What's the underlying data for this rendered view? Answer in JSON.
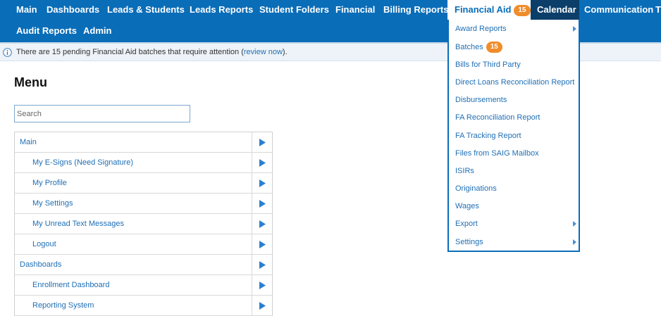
{
  "topnav": {
    "items": [
      {
        "label": "Main"
      },
      {
        "label": "Dashboards"
      },
      {
        "label": "Leads & Students"
      },
      {
        "label": "Leads Reports"
      },
      {
        "label": "Student Folders"
      },
      {
        "label": "Financial"
      },
      {
        "label": "Billing Reports"
      },
      {
        "label": "Financial Aid",
        "badge": "15"
      },
      {
        "label": "Calendar"
      },
      {
        "label": "Communication"
      },
      {
        "label": "T"
      },
      {
        "label": "Audit Reports"
      },
      {
        "label": "Admin"
      }
    ]
  },
  "alert": {
    "text_before": "There are 15 pending Financial Aid batches that require attention (",
    "link": "review now",
    "text_after": ")."
  },
  "menu": {
    "title": "Menu",
    "search_placeholder": "Search",
    "rows": [
      {
        "label": "Main",
        "level": 0
      },
      {
        "label": "My E-Signs (Need Signature)",
        "level": 1
      },
      {
        "label": "My Profile",
        "level": 1
      },
      {
        "label": "My Settings",
        "level": 1
      },
      {
        "label": "My Unread Text Messages",
        "level": 1
      },
      {
        "label": "Logout",
        "level": 1
      },
      {
        "label": "Dashboards",
        "level": 0
      },
      {
        "label": "Enrollment Dashboard",
        "level": 1
      },
      {
        "label": "Reporting System",
        "level": 1
      }
    ]
  },
  "dropdown": {
    "items": [
      {
        "label": "Award Reports",
        "submenu": true
      },
      {
        "label": "Batches",
        "badge": "15"
      },
      {
        "label": "Bills for Third Party"
      },
      {
        "label": "Direct Loans Reconciliation Report"
      },
      {
        "label": "Disbursements"
      },
      {
        "label": "FA Reconciliation Report"
      },
      {
        "label": "FA Tracking Report"
      },
      {
        "label": "Files from SAIG Mailbox"
      },
      {
        "label": "ISIRs"
      },
      {
        "label": "Originations"
      },
      {
        "label": "Wages"
      },
      {
        "label": "Export",
        "submenu": true
      },
      {
        "label": "Settings",
        "submenu": true
      }
    ]
  },
  "colors": {
    "nav_bg": "#0a6db8",
    "nav_dark": "#0b3f6a",
    "badge": "#f08c2a",
    "link": "#1f6fb5"
  }
}
